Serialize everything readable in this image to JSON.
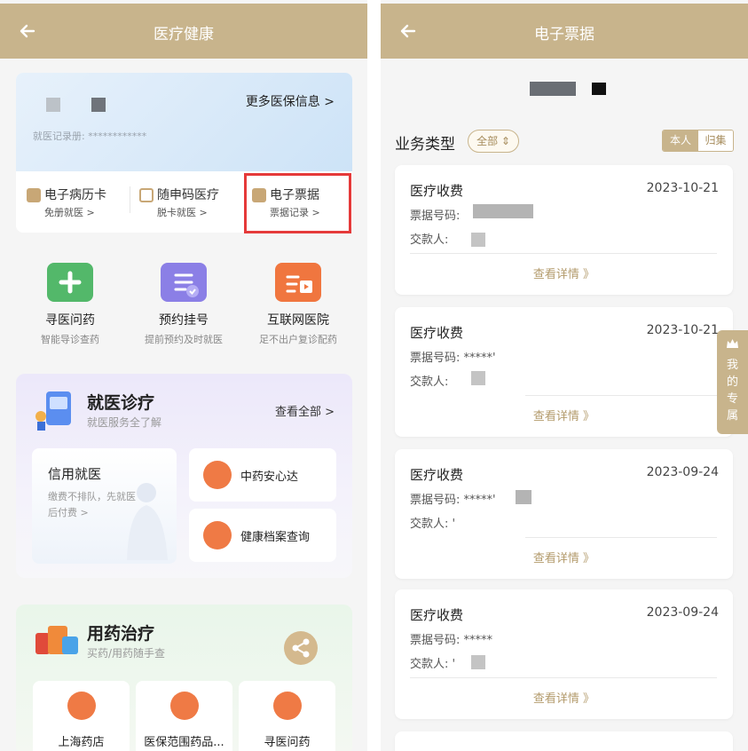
{
  "left": {
    "header": {
      "title": "医疗健康"
    },
    "insurance": {
      "more_link": "更多医保信息 >",
      "record_label": "就医记录册: ************"
    },
    "services": [
      {
        "title": "电子病历卡",
        "sub": "免册就医 >"
      },
      {
        "title": "随申码医疗",
        "sub": "脱卡就医 >"
      },
      {
        "title": "电子票据",
        "sub": "票据记录 >"
      }
    ],
    "quick": [
      {
        "title": "寻医问药",
        "sub": "智能导诊查药"
      },
      {
        "title": "预约挂号",
        "sub": "提前预约及时就医"
      },
      {
        "title": "互联网医院",
        "sub": "足不出户复诊配药"
      }
    ],
    "medical": {
      "title": "就医诊疗",
      "subtitle": "就医服务全了解",
      "view_all": "查看全部 >",
      "credit_title": "信用就医",
      "credit_desc": "缴费不排队，先就医后付费 >",
      "items": [
        "中药安心达",
        "健康档案查询"
      ]
    },
    "drugs": {
      "title": "用药治疗",
      "subtitle": "买药/用药随手查",
      "items": [
        "上海药店",
        "医保范围药品...",
        "寻医问药"
      ]
    }
  },
  "right": {
    "header": {
      "title": "电子票据"
    },
    "section_title": "业务类型",
    "filter_label": "全部 ⇕",
    "toggle": {
      "active": "本人",
      "inactive": "归集"
    },
    "side_tab": "我的专属",
    "receipts": [
      {
        "category": "医疗收费",
        "date": "2023-10-21",
        "number_label": "票据号码:",
        "number_value": "",
        "payer_label": "交款人:",
        "payer_value": "",
        "detail": "查看详情 》"
      },
      {
        "category": "医疗收费",
        "date": "2023-10-21",
        "number_label": "票据号码:",
        "number_value": "*****'",
        "payer_label": "交款人:",
        "payer_value": "",
        "detail": "查看详情 》"
      },
      {
        "category": "医疗收费",
        "date": "2023-09-24",
        "number_label": "票据号码:",
        "number_value": "*****'",
        "payer_label": "交款人:",
        "payer_value": "'",
        "detail": "查看详情 》"
      },
      {
        "category": "医疗收费",
        "date": "2023-09-24",
        "number_label": "票据号码:",
        "number_value": "*****",
        "payer_label": "交款人:",
        "payer_value": "'",
        "detail": "查看详情 》"
      }
    ],
    "colors": {
      "gold": "#c8b48c",
      "gold_text": "#a68c5c",
      "highlight_red": "#e53a3a"
    }
  }
}
